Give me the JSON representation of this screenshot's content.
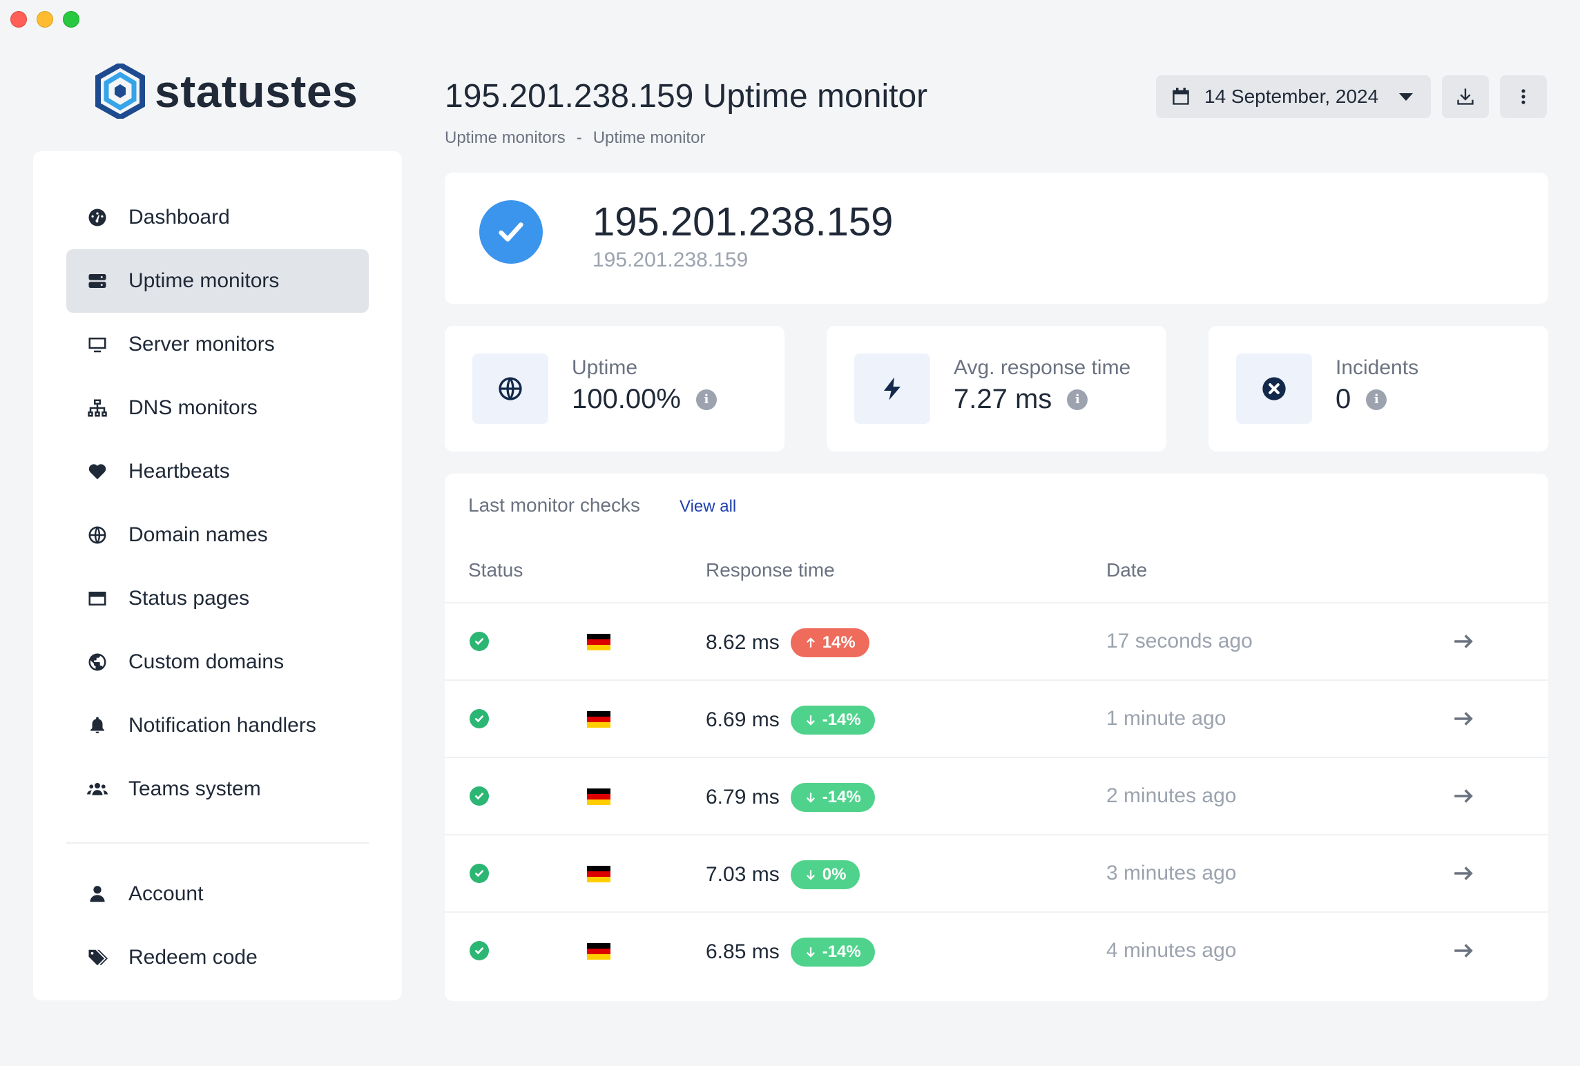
{
  "brand": {
    "name": "statustes"
  },
  "nav": {
    "items": [
      {
        "label": "Dashboard",
        "icon": "gauge-icon",
        "active": false
      },
      {
        "label": "Uptime monitors",
        "icon": "server-icon",
        "active": true
      },
      {
        "label": "Server monitors",
        "icon": "desktop-icon",
        "active": false
      },
      {
        "label": "DNS monitors",
        "icon": "network-icon",
        "active": false
      },
      {
        "label": "Heartbeats",
        "icon": "heart-pulse-icon",
        "active": false
      },
      {
        "label": "Domain names",
        "icon": "globe-icon",
        "active": false
      },
      {
        "label": "Status pages",
        "icon": "window-icon",
        "active": false
      },
      {
        "label": "Custom domains",
        "icon": "earth-icon",
        "active": false
      },
      {
        "label": "Notification handlers",
        "icon": "bell-icon",
        "active": false
      },
      {
        "label": "Teams system",
        "icon": "users-icon",
        "active": false
      }
    ],
    "bottom": [
      {
        "label": "Account",
        "icon": "user-icon"
      },
      {
        "label": "Redeem code",
        "icon": "tags-icon"
      }
    ]
  },
  "header": {
    "title": "195.201.238.159 Uptime monitor",
    "breadcrumb": [
      "Uptime monitors",
      "-",
      "Uptime monitor"
    ],
    "date": "14 September, 2024"
  },
  "monitor": {
    "name": "195.201.238.159",
    "target": "195.201.238.159"
  },
  "stats": [
    {
      "label": "Uptime",
      "value": "100.00%",
      "icon": "globe-icon"
    },
    {
      "label": "Avg. response time",
      "value": "7.27 ms",
      "icon": "bolt-icon"
    },
    {
      "label": "Incidents",
      "value": "0",
      "icon": "x-circle-icon"
    }
  ],
  "checks": {
    "title": "Last monitor checks",
    "view_all": "View all",
    "columns": {
      "status": "Status",
      "response": "Response time",
      "date": "Date"
    },
    "rows": [
      {
        "response": "8.62 ms",
        "change": "14%",
        "direction": "up",
        "when": "17 seconds ago"
      },
      {
        "response": "6.69 ms",
        "change": "-14%",
        "direction": "down",
        "when": "1 minute ago"
      },
      {
        "response": "6.79 ms",
        "change": "-14%",
        "direction": "down",
        "when": "2 minutes ago"
      },
      {
        "response": "7.03 ms",
        "change": "0%",
        "direction": "down",
        "when": "3 minutes ago"
      },
      {
        "response": "6.85 ms",
        "change": "-14%",
        "direction": "down",
        "when": "4 minutes ago"
      }
    ]
  },
  "colors": {
    "accent": "#3b95ec",
    "success": "#2bb673",
    "badge_up": "#ef6b5c",
    "badge_down": "#4fd38c"
  }
}
